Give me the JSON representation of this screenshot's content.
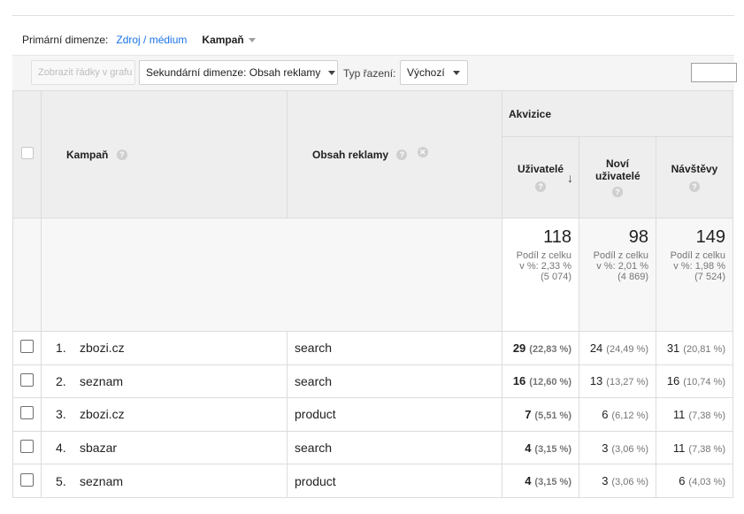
{
  "primary_dimension": {
    "label": "Primární dimenze:",
    "links": [
      "Zdroj / médium"
    ],
    "active": "Kampaň"
  },
  "toolbar": {
    "plot_rows_label": "Zobrazit řádky v grafu",
    "secondary_dimension_label": "Sekundární dimenze: Obsah reklamy",
    "sort_type_label": "Typ řazení:",
    "sort_value": "Výchozí"
  },
  "table": {
    "group_header": "Akvizice",
    "columns": {
      "campaign": "Kampaň",
      "ad_content": "Obsah reklamy",
      "users": "Uživatelé",
      "new_users": "Noví uživatelé",
      "sessions": "Návštěvy"
    },
    "help_glyph": "?",
    "totals": {
      "users": {
        "value": "118",
        "line1": "Podíl z celku",
        "line2": "v %: 2,33 %",
        "line3": "(5 074)"
      },
      "new_users": {
        "value": "98",
        "line1": "Podíl z celku",
        "line2": "v %: 2,01 %",
        "line3": "(4 869)"
      },
      "sessions": {
        "value": "149",
        "line1": "Podíl z celku",
        "line2": "v %: 1,98 %",
        "line3": "(7 524)"
      }
    },
    "rows": [
      {
        "num": "1.",
        "campaign": "zbozi.cz",
        "content": "search",
        "users": "29",
        "users_pct": "(22,83 %)",
        "new_users": "24",
        "new_users_pct": "(24,49 %)",
        "sessions": "31",
        "sessions_pct": "(20,81 %)"
      },
      {
        "num": "2.",
        "campaign": "seznam",
        "content": "search",
        "users": "16",
        "users_pct": "(12,60 %)",
        "new_users": "13",
        "new_users_pct": "(13,27 %)",
        "sessions": "16",
        "sessions_pct": "(10,74 %)"
      },
      {
        "num": "3.",
        "campaign": "zbozi.cz",
        "content": "product",
        "users": "7",
        "users_pct": "(5,51 %)",
        "new_users": "6",
        "new_users_pct": "(6,12 %)",
        "sessions": "11",
        "sessions_pct": "(7,38 %)"
      },
      {
        "num": "4.",
        "campaign": "sbazar",
        "content": "search",
        "users": "4",
        "users_pct": "(3,15 %)",
        "new_users": "3",
        "new_users_pct": "(3,06 %)",
        "sessions": "11",
        "sessions_pct": "(7,38 %)"
      },
      {
        "num": "5.",
        "campaign": "seznam",
        "content": "product",
        "users": "4",
        "users_pct": "(3,15 %)",
        "new_users": "3",
        "new_users_pct": "(3,06 %)",
        "sessions": "6",
        "sessions_pct": "(4,03 %)"
      }
    ]
  },
  "colors": {
    "link": "#1a73e8",
    "header_bg": "#eeeeee",
    "border": "#dcdcdc"
  }
}
